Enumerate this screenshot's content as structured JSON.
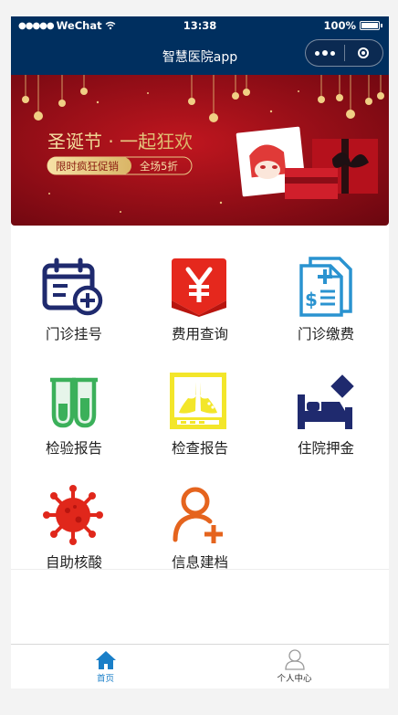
{
  "status_bar": {
    "carrier": "WeChat",
    "time": "13:38",
    "battery": "100%"
  },
  "nav": {
    "title": "智慧医院app"
  },
  "banner": {
    "title": "圣诞节 · 一起狂欢",
    "tag_left": "限时疯狂促销",
    "tag_right": "全场5折"
  },
  "menu": [
    {
      "label": "门诊挂号",
      "icon": "calendar-add-icon"
    },
    {
      "label": "费用查询",
      "icon": "yuan-icon"
    },
    {
      "label": "门诊缴费",
      "icon": "bill-add-icon"
    },
    {
      "label": "检验报告",
      "icon": "test-tubes-icon"
    },
    {
      "label": "检查报告",
      "icon": "lungs-icon"
    },
    {
      "label": "住院押金",
      "icon": "hospital-bed-icon"
    },
    {
      "label": "自助核酸",
      "icon": "virus-icon"
    },
    {
      "label": "信息建档",
      "icon": "user-add-icon"
    }
  ],
  "tabbar": {
    "home": {
      "label": "首页",
      "icon": "home-icon"
    },
    "profile": {
      "label": "个人中心",
      "icon": "user-icon"
    }
  },
  "colors": {
    "nav_bg": "#002f5f",
    "banner_red": "#a0111c",
    "tab_active": "#1a7fc8"
  }
}
